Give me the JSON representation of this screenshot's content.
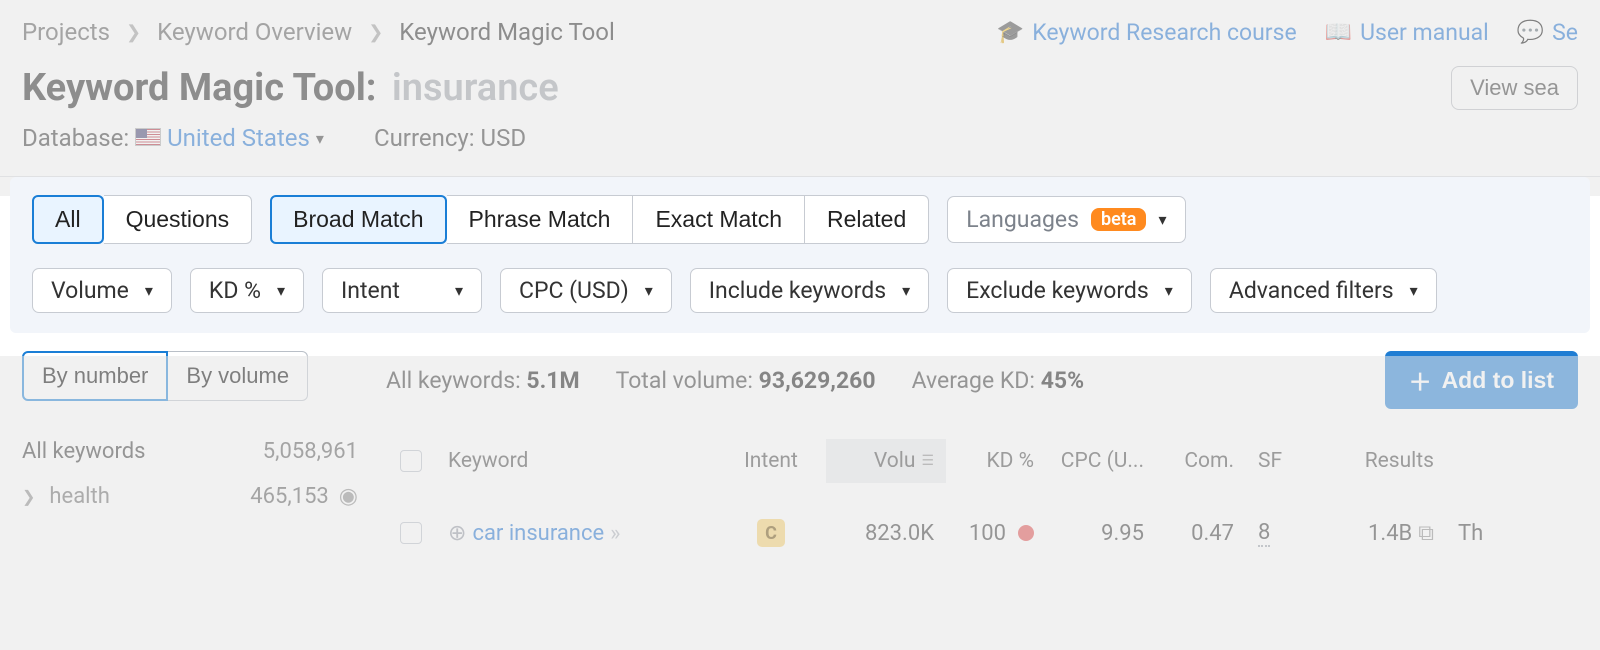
{
  "breadcrumbs": {
    "items": [
      "Projects",
      "Keyword Overview",
      "Keyword Magic Tool"
    ]
  },
  "header_links": {
    "course": "Keyword Research course",
    "manual": "User manual",
    "feedback": "Se"
  },
  "title": {
    "tool": "Keyword Magic Tool:",
    "keyword": "insurance",
    "view_search": "View sea"
  },
  "subheader": {
    "database_label": "Database:",
    "database_value": "United States",
    "currency_label": "Currency:",
    "currency_value": "USD"
  },
  "tabs1": {
    "all": "All",
    "questions": "Questions"
  },
  "match_tabs": {
    "broad": "Broad Match",
    "phrase": "Phrase Match",
    "exact": "Exact Match",
    "related": "Related"
  },
  "languages_filter": {
    "label": "Languages",
    "badge": "beta"
  },
  "filters": {
    "volume": "Volume",
    "kd": "KD %",
    "intent": "Intent",
    "cpc": "CPC (USD)",
    "include": "Include keywords",
    "exclude": "Exclude keywords",
    "advanced": "Advanced filters"
  },
  "sidebar": {
    "sort": {
      "by_number": "By number",
      "by_volume": "By volume"
    },
    "all_label": "All keywords",
    "all_count": "5,058,961",
    "items": [
      {
        "label": "health",
        "count": "465,153"
      }
    ]
  },
  "stats": {
    "all_label": "All keywords:",
    "all_value": "5.1M",
    "vol_label": "Total volume:",
    "vol_value": "93,629,260",
    "kd_label": "Average KD:",
    "kd_value": "45%",
    "add_to_list": "Add to list"
  },
  "table_headers": {
    "keyword": "Keyword",
    "intent": "Intent",
    "volume": "Volu",
    "kd": "KD %",
    "cpc": "CPC (U...",
    "com": "Com.",
    "sf": "SF",
    "results": "Results"
  },
  "table_rows": [
    {
      "keyword": "car insurance",
      "intent_code": "C",
      "volume": "823.0K",
      "kd": "100",
      "cpc": "9.95",
      "com": "0.47",
      "sf": "8",
      "results": "1.4B",
      "extra": "Th"
    }
  ]
}
